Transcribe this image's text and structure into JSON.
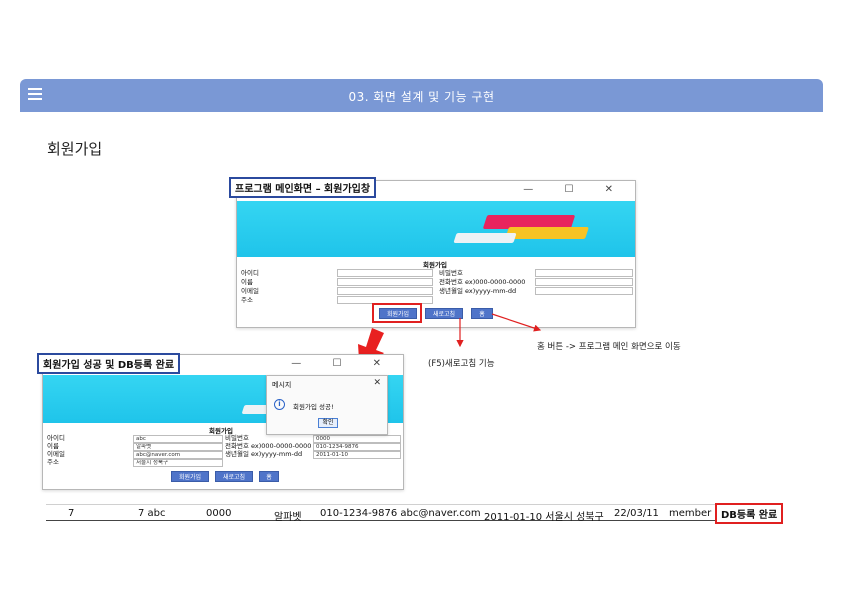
{
  "header": {
    "title": "03. 화면 설계 및 기능 구현"
  },
  "section_title": "회원가입",
  "main_window": {
    "caption": "프로그램 메인화면 – 회원가입창",
    "controls": "— ☐ ✕",
    "form_title": "회원가입",
    "labels_left": [
      "아이디",
      "이름",
      "이메일",
      "주소"
    ],
    "labels_right": [
      "비밀번호",
      "전화번호 ex)000-0000-0000",
      "생년월일 ex)yyyy-mm-dd"
    ],
    "buttons": [
      "회원가입",
      "새로고침",
      "홈"
    ]
  },
  "annotations": {
    "home_note": "홈 버튼 -> 프로그램 메인 화면으로 이동",
    "refresh_note": "(F5)새로고침 기능"
  },
  "success_window": {
    "caption": "회원가입 성공 및 DB등록 완료",
    "controls": "— ☐ ✕",
    "form_title": "회원가입",
    "labels_left": [
      "아이디",
      "이름",
      "이메일",
      "주소"
    ],
    "values_left": [
      "abc",
      "알파벳",
      "abc@naver.com",
      "서울시 성북구"
    ],
    "labels_right": [
      "비밀번호",
      "전화번호 ex)000-0000-0000",
      "생년월일 ex)yyyy-mm-dd"
    ],
    "values_right": [
      "0000",
      "010-1234-9876",
      "2011-01-10"
    ],
    "buttons": [
      "회원가입",
      "새로고침",
      "홈"
    ]
  },
  "dialog": {
    "title": "메시지",
    "close": "✕",
    "message": "회원가입 성공!",
    "ok": "확인",
    "info_icon": "i"
  },
  "db_row": {
    "cells": [
      "7",
      "7 abc",
      "0000",
      "알파벳",
      "010-1234-9876 abc@naver.com",
      "2011-01-10 서울시 성북구",
      "22/03/11",
      "member"
    ],
    "status": "DB등록 완료"
  },
  "colors": {
    "header": "#7a98d5",
    "button": "#4f74c9",
    "highlight": "#e02020",
    "banner": "#28c9ee"
  }
}
